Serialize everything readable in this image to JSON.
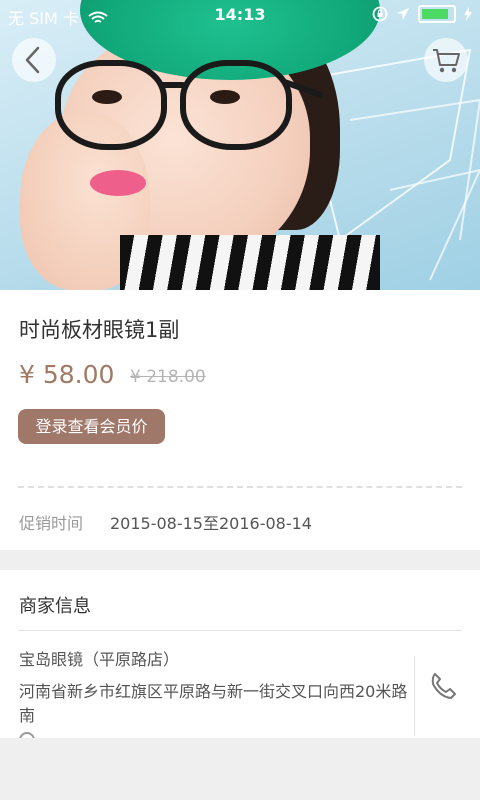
{
  "status_bar": {
    "carrier": "无 SIM 卡",
    "time": "14:13"
  },
  "icons": {
    "back": "chevron-left-icon",
    "cart": "shopping-cart-icon",
    "phone": "phone-icon",
    "location": "location-pin-icon"
  },
  "product": {
    "title": "时尚板材眼镜1副",
    "price": "¥ 58.00",
    "original_price": "¥ 218.00",
    "member_button": "登录查看会员价",
    "promo_label": "促销时间",
    "promo_value": "2015-08-15至2016-08-14"
  },
  "merchant": {
    "section_title": "商家信息",
    "name": "宝岛眼镜（平原路店）",
    "address": "河南省新乡市红旗区平原路与新一街交叉口向西20米路南"
  },
  "colors": {
    "accent": "#a0786a",
    "price": "#a17a66",
    "hat": "#11a879"
  }
}
